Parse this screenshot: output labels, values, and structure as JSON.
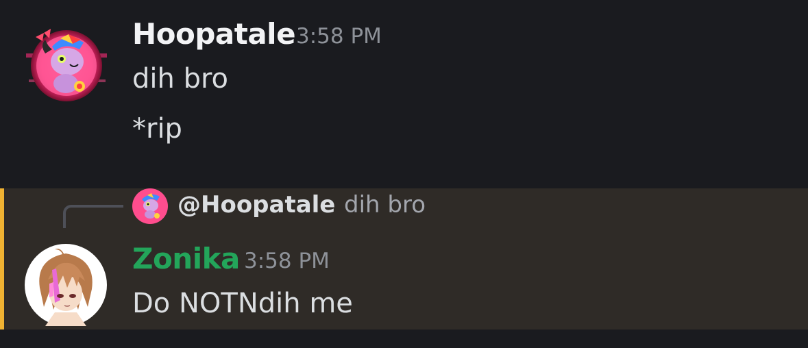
{
  "messages": [
    {
      "author": "Hoopatale",
      "author_color": "#f2f3f5",
      "timestamp": "3:58 PM",
      "lines": [
        "dih bro",
        "*rip"
      ],
      "avatar_icon": "pink-glitch-avatar"
    },
    {
      "author": "Zonika",
      "author_color": "#23a55a",
      "timestamp": "3:58 PM",
      "lines": [
        "Do NOTNdih me"
      ],
      "avatar_icon": "anime-character-avatar",
      "highlighted": true,
      "highlight_color": "#f0b232",
      "reply": {
        "author": "@Hoopatale",
        "text": "dih bro",
        "avatar_icon": "pink-glitch-avatar"
      }
    }
  ]
}
